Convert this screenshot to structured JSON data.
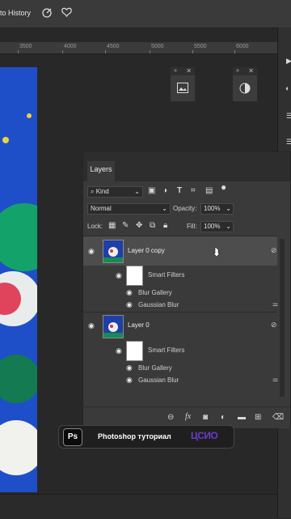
{
  "topbar": {
    "history_label": "to History"
  },
  "ruler": {
    "ticks": [
      "3500",
      "4000",
      "4500",
      "5000",
      "5500",
      "6000"
    ]
  },
  "layers_panel": {
    "tab_label": "Layers",
    "filter_kind": "Kind",
    "blend_mode": "Normal",
    "opacity_label": "Opacity:",
    "opacity_value": "100%",
    "lock_label": "Lock:",
    "fill_label": "Fill:",
    "fill_value": "100%",
    "layers": [
      {
        "name": "Layer 0 copy",
        "smart_filters": "Smart Filters",
        "filters": [
          "Blur Gallery",
          "Gaussian Blur"
        ]
      },
      {
        "name": "Layer 0",
        "smart_filters": "Smart Filters",
        "filters": [
          "Blur Gallery",
          "Gaussian Blur"
        ]
      }
    ],
    "bottom_icons": [
      "link-icon",
      "fx-icon",
      "mask-icon",
      "adjustment-icon",
      "folder-icon",
      "new-layer-icon",
      "trash-icon"
    ]
  },
  "watermark": {
    "badge": "Ps",
    "text": "Photoshop туториал",
    "logo": "ЦСИО"
  },
  "colors": {
    "canvas_blue": "#1e4fc9",
    "panel": "#3a3a3a",
    "selected_row": "#4d4d4d",
    "logo": "#6a3acb"
  }
}
